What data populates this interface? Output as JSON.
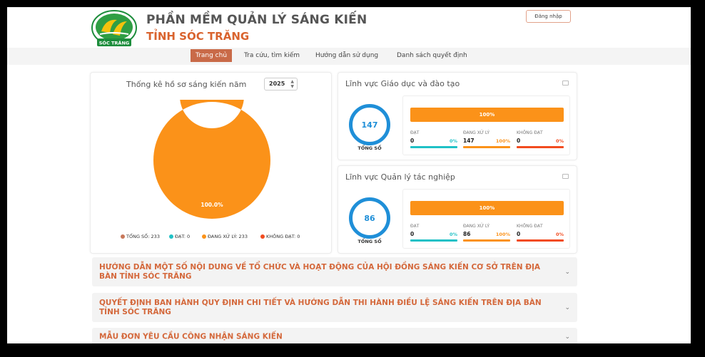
{
  "header": {
    "title": "PHẦN MỀM QUẢN LÝ SÁNG KIẾN",
    "subtitle": "TỈNH SÓC TRĂNG",
    "logo_text": "SÓC TRĂNG",
    "login_label": "Đăng nhập"
  },
  "nav": {
    "items": [
      {
        "label": "Trang chủ",
        "active": true
      },
      {
        "label": "Tra cứu, tìm kiếm",
        "active": false
      },
      {
        "label": "Hướng dẫn sử dụng",
        "active": false
      },
      {
        "label": "Danh sách quyết định",
        "active": false
      }
    ]
  },
  "stats": {
    "title": "Thống kê hồ sơ sáng kiến năm",
    "year": "2025",
    "chart_data": {
      "type": "pie",
      "categories": [
        "TỔNG SỐ",
        "ĐẠT",
        "ĐANG XỬ LÝ",
        "KHÔNG ĐẠT"
      ],
      "values": [
        233,
        0,
        233,
        0
      ],
      "slice_label": "100.0%",
      "colors": [
        "#c8785a",
        "#1fc1c6",
        "#fb9219",
        "#f24b1f"
      ]
    },
    "legend": [
      {
        "label": "TỔNG SỐ: 233",
        "color": "#c8785a"
      },
      {
        "label": "ĐẠT: 0",
        "color": "#1fc1c6"
      },
      {
        "label": "ĐANG XỬ LÝ: 233",
        "color": "#fb9219"
      },
      {
        "label": "KHÔNG ĐẠT: 0",
        "color": "#f24b1f"
      }
    ]
  },
  "fields": [
    {
      "title": "Lĩnh vực Giáo dục và đào tạo",
      "total": "147",
      "total_label": "TỔNG SỐ",
      "progress_label": "100%",
      "progress": 1.0,
      "cols": [
        {
          "label": "ĐẠT",
          "value": "0",
          "pct": "0%",
          "color": "#1fc1c6"
        },
        {
          "label": "ĐANG XỬ LÝ",
          "value": "147",
          "pct": "100%",
          "color": "#fb9219"
        },
        {
          "label": "KHÔNG ĐẠT",
          "value": "0",
          "pct": "0%",
          "color": "#f24b1f"
        }
      ]
    },
    {
      "title": "Lĩnh vực Quản lý tác nghiệp",
      "total": "86",
      "total_label": "TỔNG SỐ",
      "progress_label": "100%",
      "progress": 1.0,
      "cols": [
        {
          "label": "ĐẠT",
          "value": "0",
          "pct": "0%",
          "color": "#1fc1c6"
        },
        {
          "label": "ĐANG XỬ LÝ",
          "value": "86",
          "pct": "100%",
          "color": "#fb9219"
        },
        {
          "label": "KHÔNG ĐẠT",
          "value": "0",
          "pct": "0%",
          "color": "#f24b1f"
        }
      ]
    }
  ],
  "accordions": [
    "HƯỚNG DẪN MỘT SỐ NỘI DUNG VỀ TỔ CHỨC VÀ HOẠT ĐỘNG CỦA HỘI ĐỒNG SÁNG KIẾN CƠ SỞ TRÊN ĐỊA BÀN TỈNH SÓC TRĂNG",
    "QUYẾT ĐỊNH BAN HÀNH QUY ĐỊNH CHI TIẾT VÀ HƯỚNG DẪN THI HÀNH ĐIỀU LỆ SÁNG KIẾN TRÊN ĐỊA BÀN TỈNH SÓC TRĂNG",
    "MẪU ĐƠN YÊU CẦU CÔNG NHẬN SÁNG KIẾN"
  ],
  "icons": {
    "accordion": "chevron-down-icon",
    "field_card": "chat-icon",
    "year": "sort-arrows-icon"
  },
  "colors": {
    "accent": "#c96a48",
    "orange": "#fb9219",
    "blue": "#1f8fd8",
    "heading": "#d4683b"
  }
}
